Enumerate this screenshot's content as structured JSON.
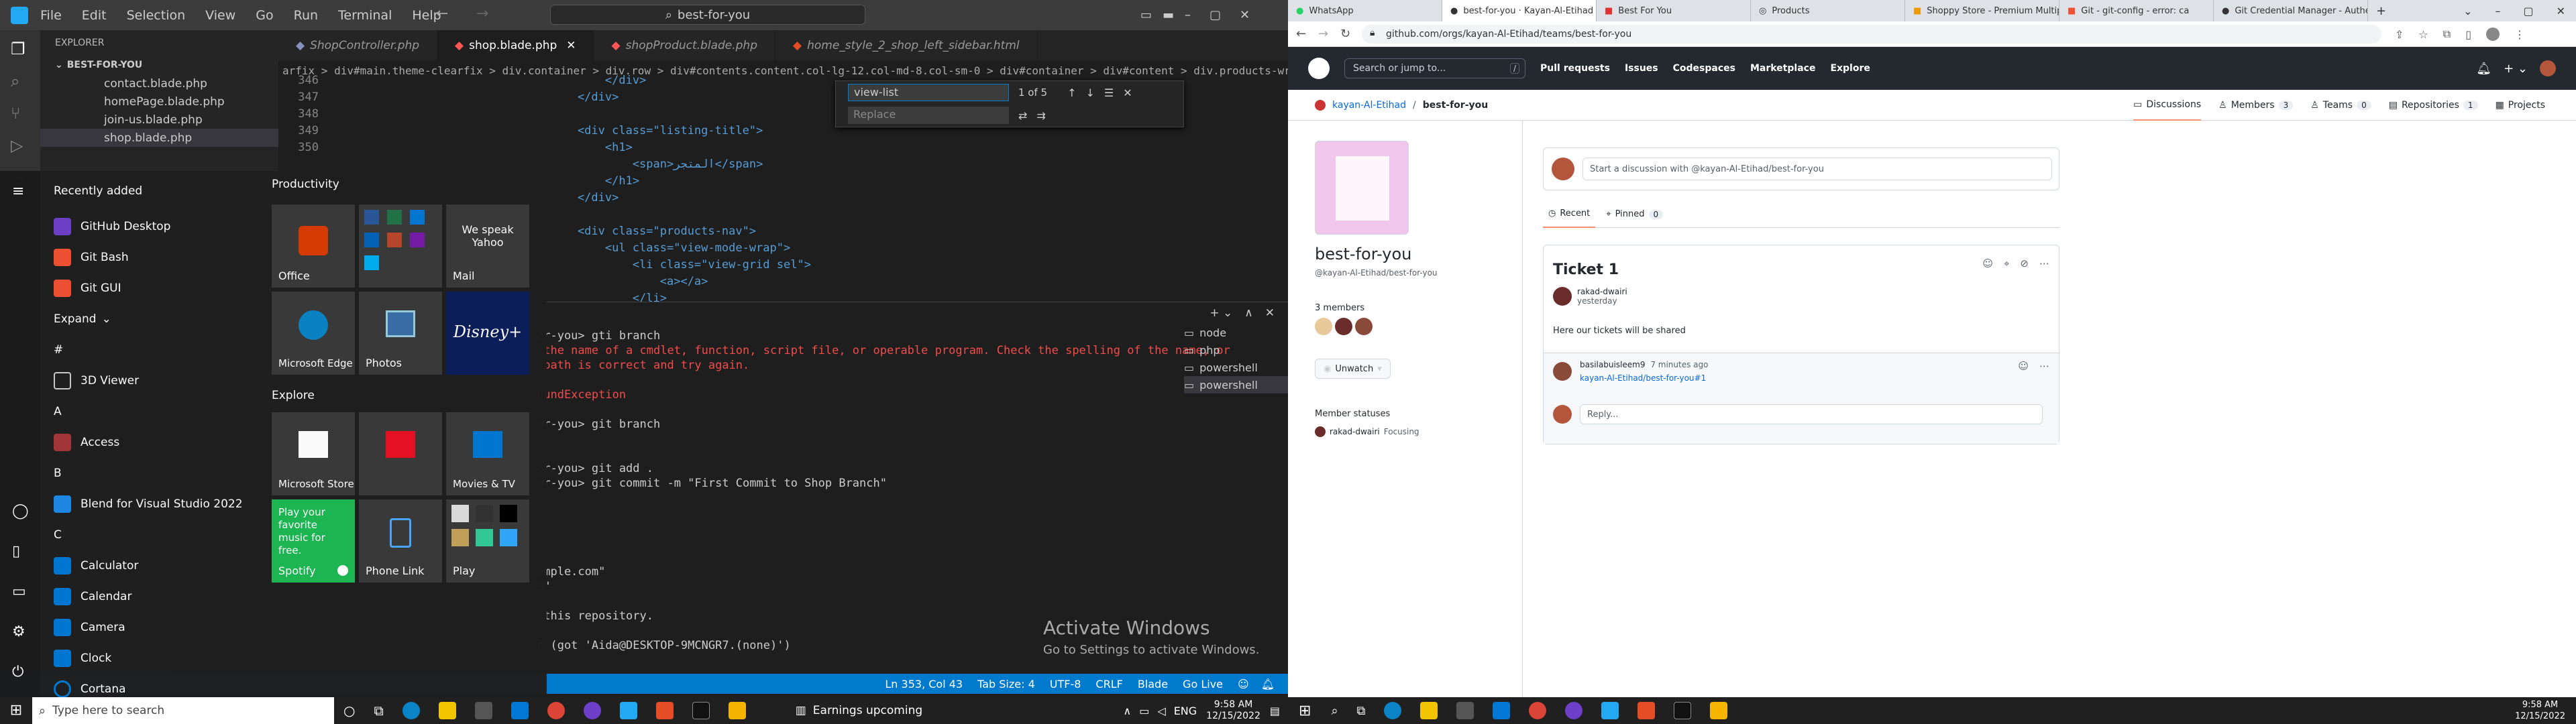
{
  "vscode": {
    "menu": [
      "File",
      "Edit",
      "Selection",
      "View",
      "Go",
      "Run",
      "Terminal",
      "Help"
    ],
    "search": "best-for-you",
    "explorer_title": "EXPLORER",
    "folder": "BEST-FOR-YOU",
    "files": [
      "contact.blade.php",
      "homePage.blade.php",
      "join-us.blade.php",
      "shop.blade.php"
    ],
    "tabs": [
      "ShopController.php",
      "shop.blade.php",
      "shopProduct.blade.php",
      "home_style_2_shop_left_sidebar.html"
    ],
    "breadcrumb": "arfix > div#main.theme-clearfix > div.container > div.row > div#contents.content.col-lg-12.col-md-8.col-sm-0 > div#container > div#content > div.products-wrapper > div.listing-title",
    "line_numbers": [
      "346",
      "347",
      "348",
      "349",
      "350"
    ],
    "code": [
      "        </div>",
      "    </div>",
      "",
      "    <div class=\"listing-title\">",
      "        <h1>",
      "            <span>المتجر</span>",
      "        </h1>",
      "    </div>",
      "",
      "    <div class=\"products-nav\">",
      "        <ul class=\"view-mode-wrap\">",
      "            <li class=\"view-grid sel\">",
      "                <a></a>",
      "            </li>"
    ],
    "find": {
      "value": "view-list",
      "count": "1 of 5",
      "replace_placeholder": "Replace"
    },
    "terminal": [
      {
        "t": "or-you> gti branch",
        "c": ""
      },
      {
        "t": " the name of a cmdlet, function, script file, or operable program. Check the spelling of the name, or",
        "c": "red"
      },
      {
        "t": " path is correct and try again.",
        "c": "red"
      },
      {
        "t": "",
        "c": ""
      },
      {
        "t": "oundException",
        "c": "red"
      },
      {
        "t": "",
        "c": ""
      },
      {
        "t": "or-you> git branch",
        "c": ""
      },
      {
        "t": "",
        "c": ""
      },
      {
        "t": "",
        "c": ""
      },
      {
        "t": "or-you> git add .",
        "c": ""
      },
      {
        "t": "or-you> git commit -m \"First Commit to Shop Branch\"",
        "c": ""
      },
      {
        "t": "",
        "c": ""
      },
      {
        "t": "",
        "c": ""
      },
      {
        "t": "",
        "c": ""
      },
      {
        "t": "",
        "c": ""
      },
      {
        "t": "",
        "c": ""
      },
      {
        "t": "ample.com\"",
        "c": ""
      },
      {
        "t": "e\"",
        "c": ""
      },
      {
        "t": "",
        "c": ""
      },
      {
        "t": " this repository.",
        "c": ""
      },
      {
        "t": "",
        "c": ""
      },
      {
        "t": "s (got 'Aida@DESKTOP-9MCNGR7.(none)')",
        "c": ""
      }
    ],
    "shells": [
      "node",
      "php",
      "powershell",
      "powershell"
    ],
    "activate_title": "Activate Windows",
    "activate_sub": "Go to Settings to activate Windows.",
    "status": [
      "Ln 353, Col 43",
      "Tab Size: 4",
      "UTF-8",
      "CRLF",
      "Blade",
      "Go Live"
    ]
  },
  "startmenu": {
    "recent_title": "Recently added",
    "recent": [
      "GitHub Desktop",
      "Git Bash",
      "Git GUI"
    ],
    "expand": "Expand",
    "apps": [
      {
        "letter": "#",
        "items": [
          "3D Viewer"
        ]
      },
      {
        "letter": "A",
        "items": [
          "Access"
        ]
      },
      {
        "letter": "B",
        "items": [
          "Blend for Visual Studio 2022"
        ]
      },
      {
        "letter": "C",
        "items": [
          "Calculator",
          "Calendar",
          "Camera",
          "Clock",
          "Cortana"
        ]
      }
    ],
    "productivity": "Productivity",
    "explore": "Explore",
    "tiles": {
      "office": "Office",
      "we_speak": "We speak Yahoo",
      "mail": "Mail",
      "edge": "Microsoft Edge",
      "photos": "Photos",
      "disney": "Disney+",
      "store": "Microsoft Store",
      "movies": "Movies & TV",
      "spotify_text": "Play your favorite music for free.",
      "spotify": "Spotify",
      "phone": "Phone Link",
      "play": "Play"
    }
  },
  "taskbar": {
    "search_placeholder": "Type here to search",
    "weather": "Earnings upcoming",
    "lang": "ENG",
    "time": "9:58 AM",
    "date": "12/15/2022",
    "time2": "9:58 AM",
    "date2": "12/15/2022"
  },
  "chrome": {
    "tabs": [
      "WhatsApp",
      "best-for-you · Kayan-Al-Etihad Te",
      "Best For You",
      "Products",
      "Shoppy Store - Premium Multipur",
      "Git - git-config - error: ca",
      "Git Credential Manager - Authe"
    ],
    "url": "github.com/orgs/kayan-Al-Etihad/teams/best-for-you"
  },
  "github": {
    "search": "Search or jump to...",
    "nav": [
      "Pull requests",
      "Issues",
      "Codespaces",
      "Marketplace",
      "Explore"
    ],
    "org": "kayan-Al-Etihad",
    "team": "best-for-you",
    "tabs": [
      {
        "label": "Discussions",
        "count": ""
      },
      {
        "label": "Members",
        "count": "3"
      },
      {
        "label": "Teams",
        "count": "0"
      },
      {
        "label": "Repositories",
        "count": "1"
      },
      {
        "label": "Projects",
        "count": ""
      }
    ],
    "team_name": "best-for-you",
    "team_handle": "@kayan-Al-Etihad/best-for-you",
    "members_label": "3 members",
    "unwatch": "Unwatch",
    "statuses_title": "Member statuses",
    "status_user": "rakad-dwairi",
    "status_text": "Focusing",
    "discussion_placeholder": "Start a discussion with @kayan-Al-Etihad/best-for-you",
    "recent": "Recent",
    "pinned": "Pinned",
    "pinned_count": "0",
    "post": {
      "title": "Ticket 1",
      "author": "rakad-dwairi",
      "time": "yesterday",
      "body": "Here our tickets will be shared"
    },
    "reply": {
      "author": "basilabuisleem9",
      "time": "7 minutes ago",
      "link": "kayan-Al-Etihad/best-for-you#1"
    },
    "reply_placeholder": "Reply..."
  }
}
